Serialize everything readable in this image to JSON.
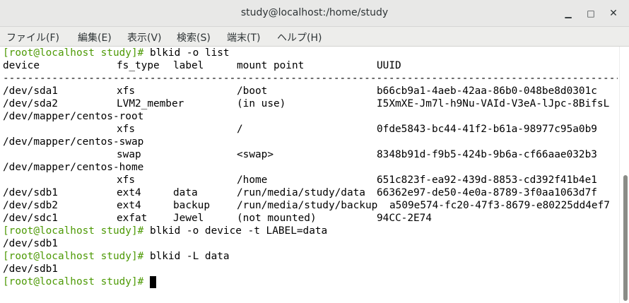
{
  "window": {
    "title": "study@localhost:/home/study",
    "min_glyph": "▁",
    "max_glyph": "□",
    "close_glyph": "✕"
  },
  "menu": [
    {
      "label": "ファイル(F)"
    },
    {
      "label": "編集(E)"
    },
    {
      "label": "表示(V)"
    },
    {
      "label": "検索(S)"
    },
    {
      "label": "端末(T)"
    },
    {
      "label": "ヘルプ(H)"
    }
  ],
  "colors": {
    "prompt": "#4e9a06",
    "text": "#000000",
    "background": "#ffffff"
  },
  "terminal": {
    "prompt": "[root@localhost study]#",
    "cmd1": " blkid -o list",
    "headers": {
      "device": "device",
      "fs_type": "fs_type",
      "label": "label",
      "mount_point": "mount point",
      "uuid": "UUID"
    },
    "separator": "------------------------------------------------------------------------------------------------------",
    "rows": [
      {
        "device": "/dev/sda1",
        "fs_type": "xfs",
        "label": "",
        "mount_point": "/boot",
        "uuid": "b66cb9a1-4aeb-42aa-86b0-048be8d0301c"
      },
      {
        "device": "/dev/sda2",
        "fs_type": "LVM2_member",
        "label": "",
        "mount_point": "(in use)",
        "uuid": "I5XmXE-Jm7l-h9Nu-VAId-V3eA-lJpc-8BifsL"
      },
      {
        "device": "/dev/mapper/centos-root"
      },
      {
        "device": "",
        "fs_type": "xfs",
        "label": "",
        "mount_point": "/",
        "uuid": "0fde5843-bc44-41f2-b61a-98977c95a0b9"
      },
      {
        "device": "/dev/mapper/centos-swap"
      },
      {
        "device": "",
        "fs_type": "swap",
        "label": "",
        "mount_point": "<swap>",
        "uuid": "8348b91d-f9b5-424b-9b6a-cf66aae032b3"
      },
      {
        "device": "/dev/mapper/centos-home"
      },
      {
        "device": "",
        "fs_type": "xfs",
        "label": "",
        "mount_point": "/home",
        "uuid": "651c823f-ea92-439d-8853-cd392f41b4e1"
      },
      {
        "device": "/dev/sdb1",
        "fs_type": "ext4",
        "label": "data",
        "mount_point": "/run/media/study/data",
        "uuid": "66362e97-de50-4e0a-8789-3f0aa1063d7f"
      },
      {
        "device": "/dev/sdb2",
        "fs_type": "ext4",
        "label": "backup",
        "mount_point": "/run/media/study/backup",
        "uuid": "a509e574-fc20-47f3-8679-e80225dd4ef7"
      },
      {
        "device": "/dev/sdc1",
        "fs_type": "exfat",
        "label": "Jewel",
        "mount_point": "(not mounted)",
        "uuid": "94CC-2E74"
      }
    ],
    "cmd2": " blkid -o device -t LABEL=data",
    "out2": "/dev/sdb1",
    "cmd3": " blkid -L data",
    "out3": "/dev/sdb1"
  }
}
